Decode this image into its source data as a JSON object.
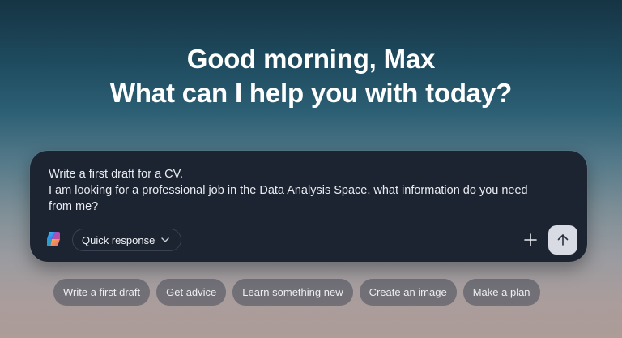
{
  "greeting": {
    "line1": "Good morning, Max",
    "line2": "What can I help you with today?"
  },
  "composer": {
    "text_lines": [
      "Write a first draft for a CV.",
      "I am looking for a professional job in the Data Analysis Space, what information do you need",
      "from me?"
    ],
    "mode_label": "Quick response",
    "logo_icon": "copilot-logo-icon",
    "plus_icon": "plus-icon",
    "send_icon": "arrow-up-icon"
  },
  "suggestions": [
    "Write a first draft",
    "Get advice",
    "Learn something new",
    "Create an image",
    "Make a plan"
  ],
  "colors": {
    "composer_bg": "#1c2331",
    "send_button_bg": "#d8dbe3",
    "chip_bg": "#464a58"
  }
}
